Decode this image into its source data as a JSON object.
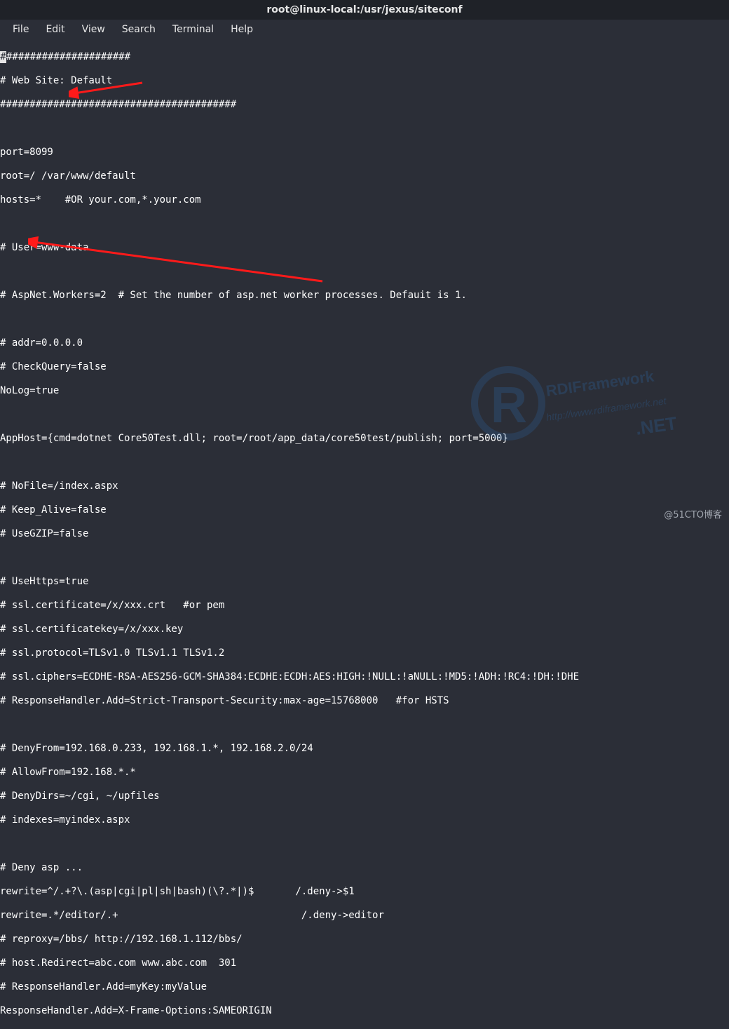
{
  "window": {
    "title": "root@linux-local:/usr/jexus/siteconf"
  },
  "menus": {
    "file": "File",
    "edit": "Edit",
    "view": "View",
    "search": "Search",
    "terminal": "Terminal",
    "help": "Help"
  },
  "lines": {
    "l0_rest": "#####################",
    "l1": "# Web Site: Default",
    "l2": "########################################",
    "l3": "port=8099",
    "l4": "root=/ /var/www/default",
    "l5": "hosts=*    #OR your.com,*.your.com",
    "l6": "# User=www-data",
    "l7": "# AspNet.Workers=2  # Set the number of asp.net worker processes. Defauit is 1.",
    "l8": "# addr=0.0.0.0",
    "l9": "# CheckQuery=false",
    "l10": "NoLog=true",
    "l11": "AppHost={cmd=dotnet Core50Test.dll; root=/root/app_data/core50test/publish; port=5000}",
    "l12": "# NoFile=/index.aspx",
    "l13": "# Keep_Alive=false",
    "l14": "# UseGZIP=false",
    "l15": "# UseHttps=true",
    "l16": "# ssl.certificate=/x/xxx.crt   #or pem",
    "l17": "# ssl.certificatekey=/x/xxx.key",
    "l18": "# ssl.protocol=TLSv1.0 TLSv1.1 TLSv1.2",
    "l19": "# ssl.ciphers=ECDHE-RSA-AES256-GCM-SHA384:ECDHE:ECDH:AES:HIGH:!NULL:!aNULL:!MD5:!ADH:!RC4:!DH:!DHE",
    "l20": "# ResponseHandler.Add=Strict-Transport-Security:max-age=15768000   #for HSTS",
    "l21": "# DenyFrom=192.168.0.233, 192.168.1.*, 192.168.2.0/24",
    "l22": "# AllowFrom=192.168.*.*",
    "l23": "# DenyDirs=~/cgi, ~/upfiles",
    "l24": "# indexes=myindex.aspx",
    "l25": "# Deny asp ...",
    "l26": "rewrite=^/.+?\\.(asp|cgi|pl|sh|bash)(\\?.*|)$       /.deny->$1",
    "l27": "rewrite=.*/editor/.+                               /.deny->editor",
    "l28": "# reproxy=/bbs/ http://192.168.1.112/bbs/",
    "l29": "# host.Redirect=abc.com www.abc.com  301",
    "l30": "# ResponseHandler.Add=myKey:myValue",
    "l31": "ResponseHandler.Add=X-Frame-Options:SAMEORIGIN"
  },
  "watermark": {
    "credit": "@51CTO博客"
  }
}
